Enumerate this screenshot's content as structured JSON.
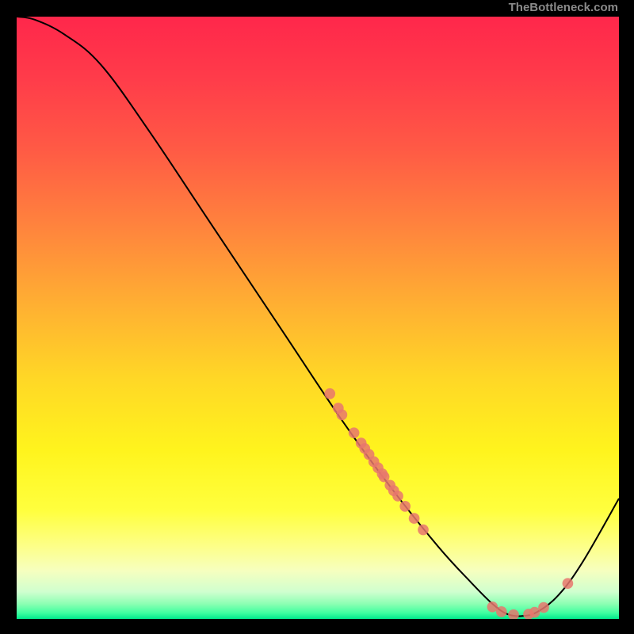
{
  "attribution": "TheBottleneck.com",
  "chart_data": {
    "type": "line",
    "title": "",
    "xlabel": "",
    "ylabel": "",
    "xlim": [
      0,
      100
    ],
    "ylim": [
      0,
      100
    ],
    "curve": [
      {
        "x": 0.0,
        "y": 100.0
      },
      {
        "x": 3.0,
        "y": 99.5
      },
      {
        "x": 8.0,
        "y": 97.0
      },
      {
        "x": 14.0,
        "y": 92.0
      },
      {
        "x": 22.0,
        "y": 81.0
      },
      {
        "x": 32.0,
        "y": 66.0
      },
      {
        "x": 44.0,
        "y": 48.0
      },
      {
        "x": 54.0,
        "y": 33.0
      },
      {
        "x": 62.0,
        "y": 22.0
      },
      {
        "x": 70.0,
        "y": 12.0
      },
      {
        "x": 75.5,
        "y": 6.0
      },
      {
        "x": 79.0,
        "y": 2.5
      },
      {
        "x": 81.5,
        "y": 0.8
      },
      {
        "x": 84.0,
        "y": 0.5
      },
      {
        "x": 86.5,
        "y": 1.2
      },
      {
        "x": 90.0,
        "y": 4.0
      },
      {
        "x": 94.0,
        "y": 9.5
      },
      {
        "x": 100.0,
        "y": 20.0
      }
    ],
    "points": [
      {
        "x": 52.0,
        "y": 37.4
      },
      {
        "x": 53.4,
        "y": 35.0
      },
      {
        "x": 54.0,
        "y": 33.9
      },
      {
        "x": 56.0,
        "y": 30.9
      },
      {
        "x": 57.2,
        "y": 29.2
      },
      {
        "x": 57.8,
        "y": 28.3
      },
      {
        "x": 58.5,
        "y": 27.3
      },
      {
        "x": 59.3,
        "y": 26.1
      },
      {
        "x": 60.0,
        "y": 25.1
      },
      {
        "x": 60.7,
        "y": 24.1
      },
      {
        "x": 61.0,
        "y": 23.6
      },
      {
        "x": 62.0,
        "y": 22.2
      },
      {
        "x": 62.6,
        "y": 21.3
      },
      {
        "x": 63.3,
        "y": 20.4
      },
      {
        "x": 64.5,
        "y": 18.7
      },
      {
        "x": 66.0,
        "y": 16.7
      },
      {
        "x": 67.5,
        "y": 14.8
      },
      {
        "x": 79.0,
        "y": 2.0
      },
      {
        "x": 80.5,
        "y": 1.2
      },
      {
        "x": 82.5,
        "y": 0.7
      },
      {
        "x": 85.0,
        "y": 0.8
      },
      {
        "x": 86.0,
        "y": 1.1
      },
      {
        "x": 87.5,
        "y": 1.9
      },
      {
        "x": 91.5,
        "y": 5.9
      }
    ],
    "point_color": "#e8776d",
    "line_color": "#000000",
    "gradient_stops": [
      {
        "offset": 0.0,
        "color": "#ff274b"
      },
      {
        "offset": 0.1,
        "color": "#ff3b4a"
      },
      {
        "offset": 0.22,
        "color": "#ff5a45"
      },
      {
        "offset": 0.35,
        "color": "#ff843d"
      },
      {
        "offset": 0.48,
        "color": "#ffb032"
      },
      {
        "offset": 0.6,
        "color": "#ffd726"
      },
      {
        "offset": 0.72,
        "color": "#fff41d"
      },
      {
        "offset": 0.82,
        "color": "#ffff3e"
      },
      {
        "offset": 0.88,
        "color": "#fdff89"
      },
      {
        "offset": 0.92,
        "color": "#f6ffbf"
      },
      {
        "offset": 0.955,
        "color": "#d0ffcf"
      },
      {
        "offset": 0.975,
        "color": "#8cffb3"
      },
      {
        "offset": 0.99,
        "color": "#3fffa0"
      },
      {
        "offset": 1.0,
        "color": "#00e98c"
      }
    ]
  }
}
